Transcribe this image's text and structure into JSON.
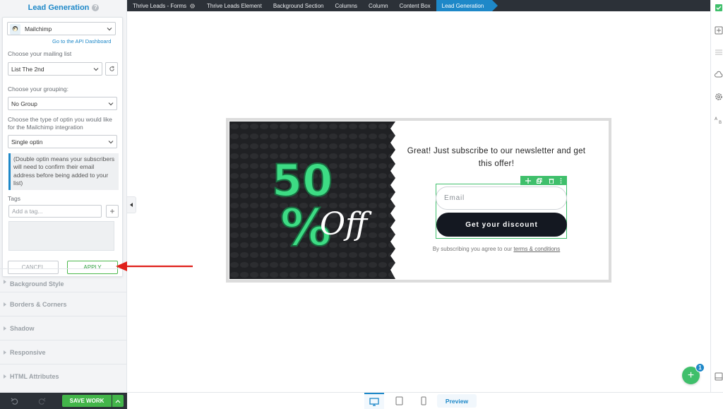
{
  "left_panel": {
    "title": "Lead Generation",
    "service": {
      "name": "Mailchimp",
      "api_link": "Go to the API Dashboard"
    },
    "mailing_list": {
      "label": "Choose your mailing list",
      "value": "List The 2nd"
    },
    "grouping": {
      "label": "Choose your grouping:",
      "value": "No Group"
    },
    "optin": {
      "label": "Choose the type of optin you would like for the Mailchimp integration",
      "value": "Single optin",
      "info": "(Double optin means your subscribers will need to confirm their email address before being added to your list)"
    },
    "tags": {
      "label": "Tags",
      "placeholder": "Add a tag..."
    },
    "cancel_label": "CANCEL",
    "apply_label": "APPLY",
    "sections": [
      "Background Style",
      "Borders & Corners",
      "Shadow",
      "Responsive",
      "HTML Attributes"
    ]
  },
  "breadcrumb": [
    "Thrive Leads - Forms",
    "Thrive Leads Element",
    "Background Section",
    "Columns",
    "Column",
    "Content Box",
    "Lead Generation"
  ],
  "optin": {
    "heading": "Great! Just subscribe to our newsletter and get this offer!",
    "email_placeholder": "Email",
    "button_label": "Get your discount",
    "disclaimer_prefix": "By subscribing you agree to our ",
    "disclaimer_link": "terms & conditions",
    "image_text_big": "50",
    "image_text_pct": "%",
    "image_text_off": "Off"
  },
  "bottom": {
    "save_label": "SAVE WORK",
    "preview_label": "Preview"
  },
  "fab": {
    "badge": "1"
  },
  "colors": {
    "accent": "#1e88c8",
    "green": "#43b54a",
    "dark": "#2c3138",
    "promo_green": "#3ddc84",
    "arrow": "#e0201b"
  }
}
